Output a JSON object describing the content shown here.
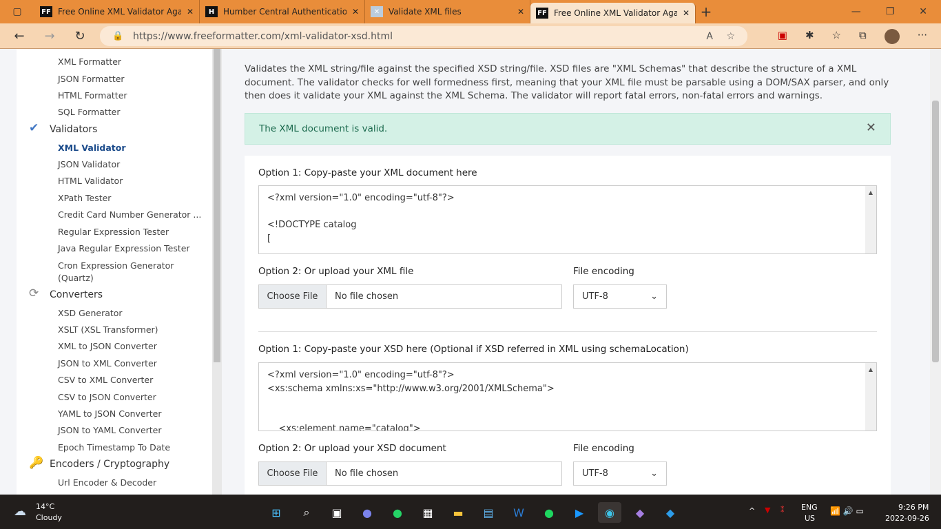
{
  "browser": {
    "tabs": [
      {
        "title": "Free Online XML Validator Against",
        "fav": "FF"
      },
      {
        "title": "Humber Central Authentication S",
        "fav": "H"
      },
      {
        "title": "Validate XML files",
        "fav": "✕"
      },
      {
        "title": "Free Online XML Validator Against",
        "fav": "FF"
      }
    ],
    "url": "https://www.freeformatter.com/xml-validator-xsd.html"
  },
  "sidebar": {
    "groups": [
      {
        "items": [
          "XML Formatter",
          "JSON Formatter",
          "HTML Formatter",
          "SQL Formatter"
        ]
      },
      {
        "heading": "Validators",
        "items": [
          "XML Validator",
          "JSON Validator",
          "HTML Validator",
          "XPath Tester",
          "Credit Card Number Generator ...",
          "Regular Expression Tester",
          "Java Regular Expression Tester",
          "Cron Expression Generator (Quartz)"
        ]
      },
      {
        "heading": "Converters",
        "items": [
          "XSD Generator",
          "XSLT (XSL Transformer)",
          "XML to JSON Converter",
          "JSON to XML Converter",
          "CSV to XML Converter",
          "CSV to JSON Converter",
          "YAML to JSON Converter",
          "JSON to YAML Converter",
          "Epoch Timestamp To Date"
        ]
      },
      {
        "heading": "Encoders / Cryptography",
        "items": [
          "Url Encoder & Decoder"
        ]
      }
    ]
  },
  "main": {
    "description": "Validates the XML string/file against the specified XSD string/file. XSD files are \"XML Schemas\" that describe the structure of a XML document. The validator checks for well formedness first, meaning that your XML file must be parsable using a DOM/SAX parser, and only then does it validate your XML against the XML Schema. The validator will report fatal errors, non-fatal errors and warnings.",
    "alert": "The XML document is valid.",
    "xml_label": "Option 1: Copy-paste your XML document here",
    "xml_text": "<?xml version=\"1.0\" encoding=\"utf-8\"?>\n\n<!DOCTYPE catalog\n[",
    "xml_upload_label": "Option 2: Or upload your XML file",
    "xsd_label": "Option 1: Copy-paste your XSD here (Optional if XSD referred in XML using schemaLocation)",
    "xsd_text": "<?xml version=\"1.0\" encoding=\"utf-8\"?>\n<xs:schema xmlns:xs=\"http://www.w3.org/2001/XMLSchema\">\n\n\n    <xs:element name=\"catalog\">",
    "xsd_upload_label": "Option 2: Or upload your XSD document",
    "encoding_label": "File encoding",
    "encoding_value": "UTF-8",
    "choose_file": "Choose File",
    "no_file": "No file chosen"
  },
  "taskbar": {
    "temp": "14°C",
    "weather": "Cloudy",
    "lang1": "ENG",
    "lang2": "US",
    "time": "9:26 PM",
    "date": "2022-09-26"
  }
}
